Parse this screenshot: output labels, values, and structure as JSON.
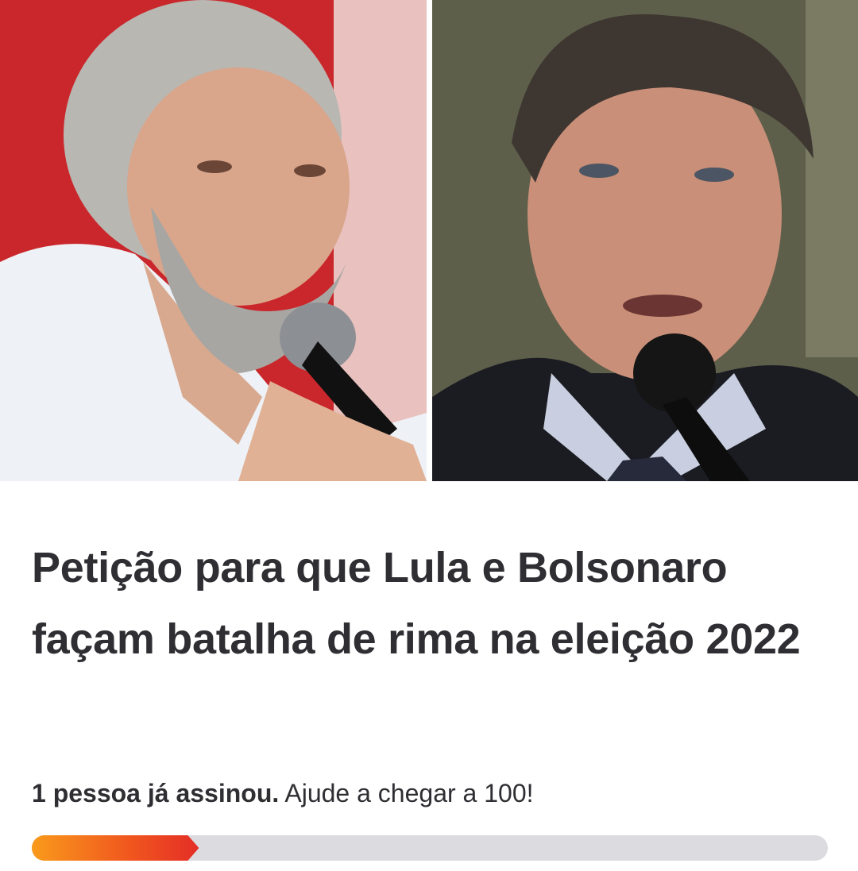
{
  "photos": {
    "left": {
      "alt": "Lula"
    },
    "right": {
      "alt": "Bolsonaro"
    }
  },
  "petition": {
    "title": "Petição para que Lula e Bolsonaro façam batalha de rima na eleição 2022",
    "signed_text": "1 pessoa já assinou.",
    "goal_text": " Ajude a chegar a 100!",
    "signatures": 1,
    "goal": 100,
    "progress_fraction": 0.21
  },
  "colors": {
    "progress_start": "#f99a1c",
    "progress_end": "#e42e27",
    "track": "#dcdbe0",
    "text": "#2f2e33"
  }
}
